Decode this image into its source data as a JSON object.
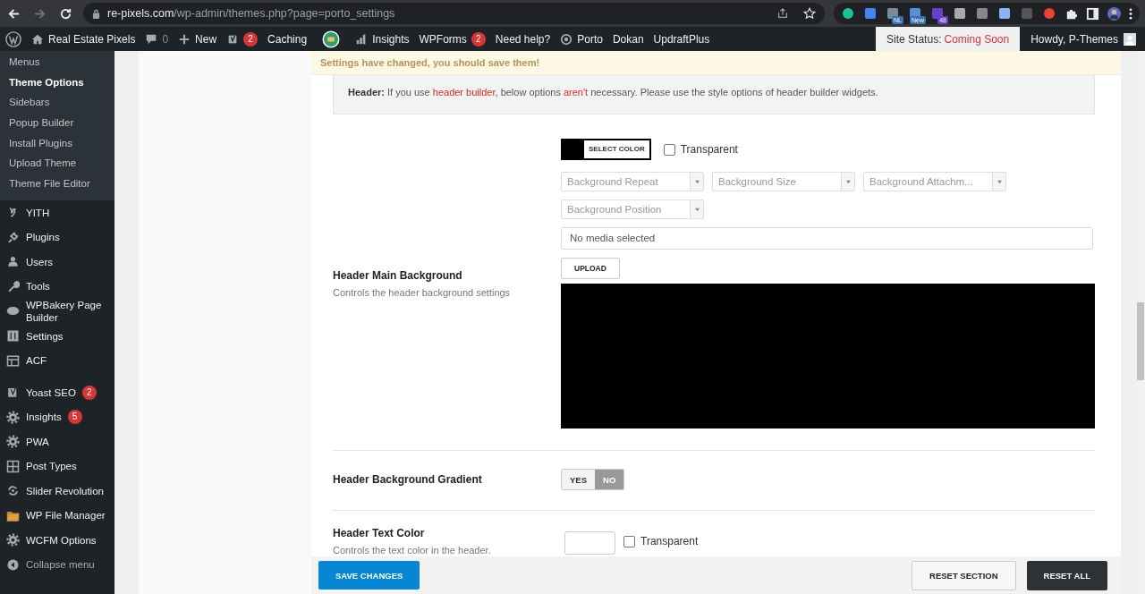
{
  "browser": {
    "url_host": "re-pixels.com",
    "url_path": "/wp-admin/themes.php?page=porto_settings",
    "extension_badges": [
      "NL",
      "New",
      "48"
    ]
  },
  "admin_bar": {
    "items": [
      {
        "label": "Real Estate Pixels"
      },
      {
        "label": "0"
      },
      {
        "label": "New"
      },
      {
        "badge": "2"
      },
      {
        "label": "Caching"
      },
      {
        "label": "Insights"
      },
      {
        "label": "WPForms",
        "badge": "2"
      },
      {
        "label": "Need help?"
      },
      {
        "label": "Porto"
      },
      {
        "label": "Dokan"
      },
      {
        "label": "UpdraftPlus"
      }
    ],
    "site_status_label": "Site Status:",
    "site_status_value": "Coming Soon",
    "greeting": "Howdy, P-Themes"
  },
  "sidebar": {
    "submenu": [
      {
        "label": "Menus",
        "selected": false
      },
      {
        "label": "Theme Options",
        "selected": true
      },
      {
        "label": "Sidebars",
        "selected": false
      },
      {
        "label": "Popup Builder",
        "selected": false
      },
      {
        "label": "Install Plugins",
        "selected": false
      },
      {
        "label": "Upload Theme",
        "selected": false
      },
      {
        "label": "Theme File Editor",
        "selected": false
      }
    ],
    "items": [
      {
        "label": "YITH"
      },
      {
        "label": "Plugins"
      },
      {
        "label": "Users"
      },
      {
        "label": "Tools"
      },
      {
        "label": "WPBakery Page Builder"
      },
      {
        "label": "Settings"
      },
      {
        "label": "ACF"
      },
      {
        "label": "Yoast SEO",
        "badge": "2"
      },
      {
        "label": "Insights",
        "badge": "5"
      },
      {
        "label": "PWA"
      },
      {
        "label": "Post Types"
      },
      {
        "label": "Slider Revolution"
      },
      {
        "label": "WP File Manager"
      },
      {
        "label": "WCFM Options"
      }
    ],
    "collapse": "Collapse menu"
  },
  "notice": "Settings have changed, you should save them!",
  "info": [
    {
      "kind": "label",
      "text": "Header:"
    },
    {
      "kind": "text",
      "text": " If you use "
    },
    {
      "kind": "highlight",
      "text": "header builder"
    },
    {
      "kind": "text",
      "text": ", below options "
    },
    {
      "kind": "highlight",
      "text": "aren't"
    },
    {
      "kind": "text",
      "text": " necessary. Please use the style options of header builder widgets."
    }
  ],
  "main_background": {
    "title": "Header Main Background",
    "description": "Controls the header background settings",
    "color": "#000000",
    "select_color": "SELECT COLOR",
    "transparent_label": "Transparent",
    "transparent_checked": false,
    "selects": [
      "Background Repeat",
      "Background Size",
      "Background Attachm...",
      "Background Position"
    ],
    "media_value": "No media selected",
    "upload": "UPLOAD"
  },
  "gradient": {
    "title": "Header Background Gradient",
    "options": [
      {
        "label": "YES",
        "selected": false
      },
      {
        "label": "NO",
        "selected": true
      }
    ]
  },
  "text_color": {
    "title": "Header Text Color",
    "description": "Controls the text color in the header.",
    "color": "#ffffff",
    "transparent_label": "Transparent",
    "transparent_checked": false
  },
  "footer": {
    "save": "SAVE CHANGES",
    "reset_section": "RESET SECTION",
    "reset_all": "RESET ALL"
  }
}
